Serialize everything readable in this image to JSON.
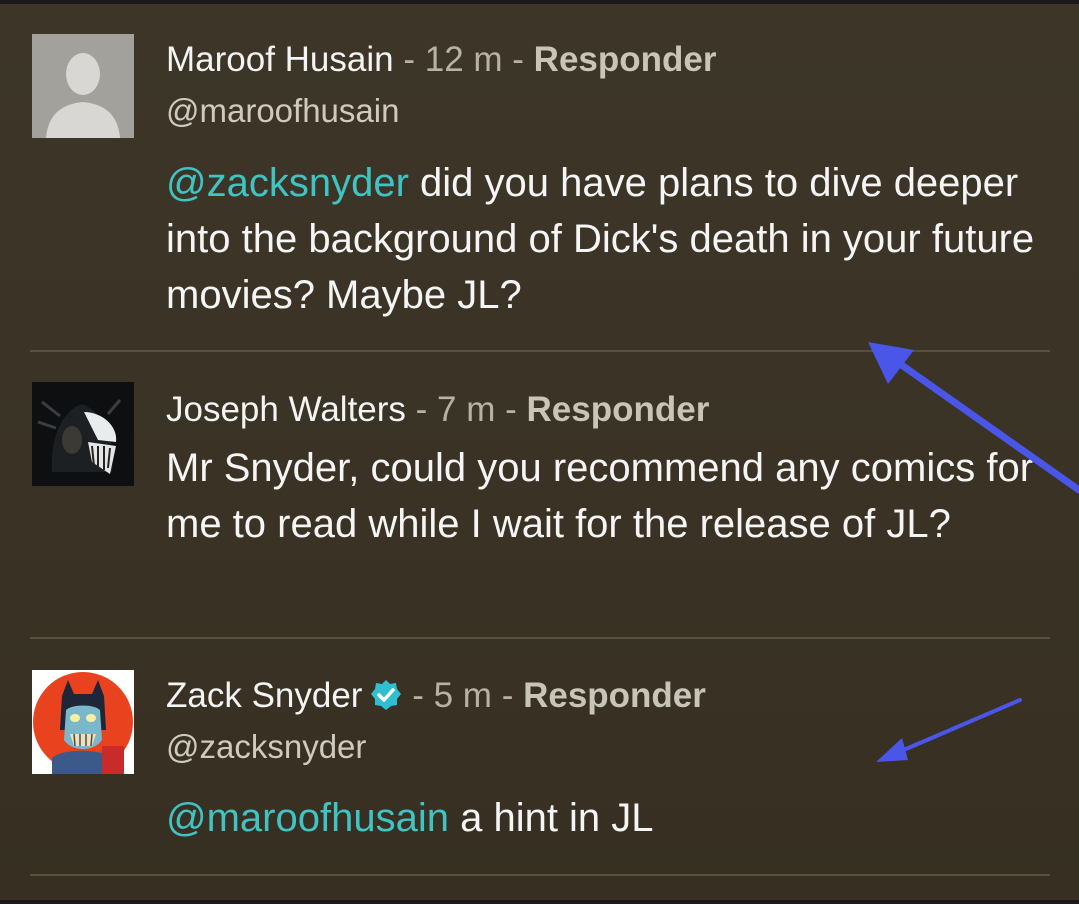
{
  "comments": [
    {
      "name": "Maroof Husain",
      "separator": "-",
      "time": "12 m",
      "reply_label": "Responder",
      "handle": "@maroofhusain",
      "mention": "@zacksnyder",
      "body": " did you have plans to dive deeper into the background of Dick's death in your future movies? Maybe JL?"
    },
    {
      "name": "Joseph Walters",
      "separator": "-",
      "time": "7 m",
      "reply_label": "Responder",
      "handle": "",
      "mention": "",
      "body": "Mr Snyder, could you recommend any comics for me to read while I wait for the release of JL?"
    },
    {
      "name": "Zack Snyder",
      "separator": "-",
      "time": "5 m",
      "reply_label": "Responder",
      "handle": "@zacksnyder",
      "mention": "@maroofhusain",
      "body": " a hint in JL",
      "verified": true
    }
  ],
  "colors": {
    "background": "#3a3426",
    "mention": "#3fc3c3",
    "verified_badge": "#2fbfd0",
    "annotation_arrow": "#4a56e8"
  },
  "icons": {
    "default_avatar": "person-silhouette-icon",
    "verified": "verified-check-icon",
    "annotation": "arrow-annotation-icon"
  }
}
